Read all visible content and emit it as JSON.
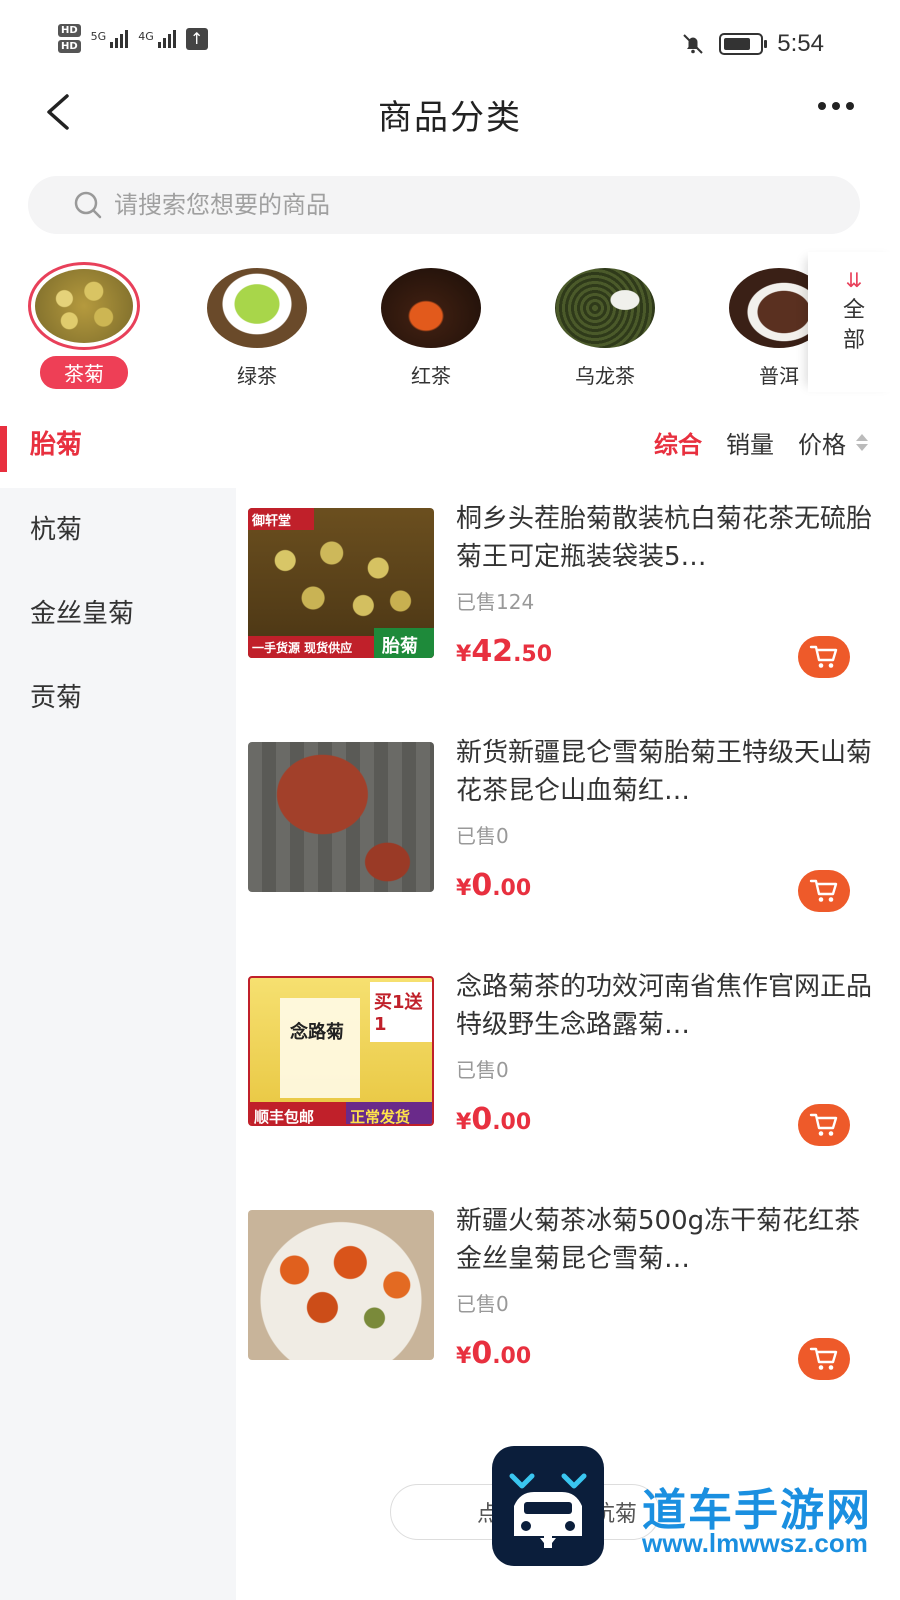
{
  "status_bar": {
    "hd1": "HD",
    "hd2": "HD",
    "net1": "5G",
    "net2": "4G",
    "time": "5:54",
    "battery_level": 0.75
  },
  "header": {
    "title": "商品分类"
  },
  "search": {
    "placeholder": "请搜索您想要的商品"
  },
  "categories": [
    {
      "label": "茶菊",
      "active": true
    },
    {
      "label": "绿茶",
      "active": false
    },
    {
      "label": "红茶",
      "active": false
    },
    {
      "label": "乌龙茶",
      "active": false
    },
    {
      "label": "普洱",
      "active": false
    }
  ],
  "all_button": {
    "label_1": "全",
    "label_2": "部"
  },
  "sidebar": {
    "items": [
      {
        "label": "胎菊",
        "active": true
      },
      {
        "label": "杭菊",
        "active": false
      },
      {
        "label": "金丝皇菊",
        "active": false
      },
      {
        "label": "贡菊",
        "active": false
      }
    ]
  },
  "sort": {
    "comprehensive": "综合",
    "sales": "销量",
    "price": "价格"
  },
  "products": [
    {
      "title": "桐乡头茬胎菊散装杭白菊花茶无硫胎菊王可定瓶装袋装5…",
      "sold": "已售124",
      "price_symbol": "¥",
      "price_int": "42",
      "price_dec": ".50",
      "image_text_1": "御轩堂",
      "image_text_2": "一手货源 现货供应",
      "image_text_3": "胎菊"
    },
    {
      "title": "新货新疆昆仑雪菊胎菊王特级天山菊花茶昆仑山血菊红…",
      "sold": "已售0",
      "price_symbol": "¥",
      "price_int": "0",
      "price_dec": ".00"
    },
    {
      "title": "念路菊茶的功效河南省焦作官网正品特级野生念路露菊…",
      "sold": "已售0",
      "price_symbol": "¥",
      "price_int": "0",
      "price_dec": ".00",
      "image_text_1": "念路菊",
      "image_text_2": "买1送1",
      "image_text_3": "顺丰包邮",
      "image_text_4": "正常发货"
    },
    {
      "title": "新疆火菊茶冰菊500g冻干菊花红茶金丝皇菊昆仑雪菊…",
      "sold": "已售0",
      "price_symbol": "¥",
      "price_int": "0",
      "price_dec": ".00"
    }
  ],
  "bottom_hint": {
    "left": "点",
    "right": "杭菊"
  },
  "watermark": {
    "title": "道车手游网",
    "url": "www.lmwwsz.com"
  },
  "colors": {
    "accent": "#e8303f",
    "cart": "#ee5a2a",
    "sidebar_bg": "#f5f6f8",
    "watermark": "#1a8fe0"
  }
}
